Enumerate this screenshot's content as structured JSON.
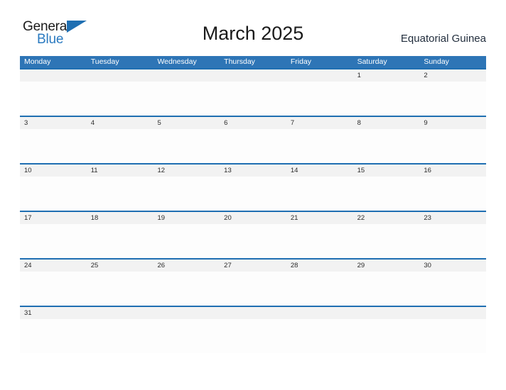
{
  "brand": {
    "name_part1": "General",
    "name_part2": "Blue",
    "flag_icon": "triangle-flag-icon",
    "color_dark": "#1a1a1a",
    "color_blue": "#2a7ac0"
  },
  "header": {
    "title": "March 2025",
    "region": "Equatorial Guinea"
  },
  "colors": {
    "header_band": "#2e75b6",
    "row_divider": "#1f6fb2",
    "date_strip": "#f2f2f2",
    "cell_body": "#fdfdfd",
    "page_background": "#ffffff"
  },
  "calendar": {
    "month": "March",
    "year": "2025",
    "weekdays": [
      "Monday",
      "Tuesday",
      "Wednesday",
      "Thursday",
      "Friday",
      "Saturday",
      "Sunday"
    ],
    "weeks": [
      [
        "",
        "",
        "",
        "",
        "",
        "1",
        "2"
      ],
      [
        "3",
        "4",
        "5",
        "6",
        "7",
        "8",
        "9"
      ],
      [
        "10",
        "11",
        "12",
        "13",
        "14",
        "15",
        "16"
      ],
      [
        "17",
        "18",
        "19",
        "20",
        "21",
        "22",
        "23"
      ],
      [
        "24",
        "25",
        "26",
        "27",
        "28",
        "29",
        "30"
      ],
      [
        "31",
        "",
        "",
        "",
        "",
        "",
        ""
      ]
    ]
  }
}
